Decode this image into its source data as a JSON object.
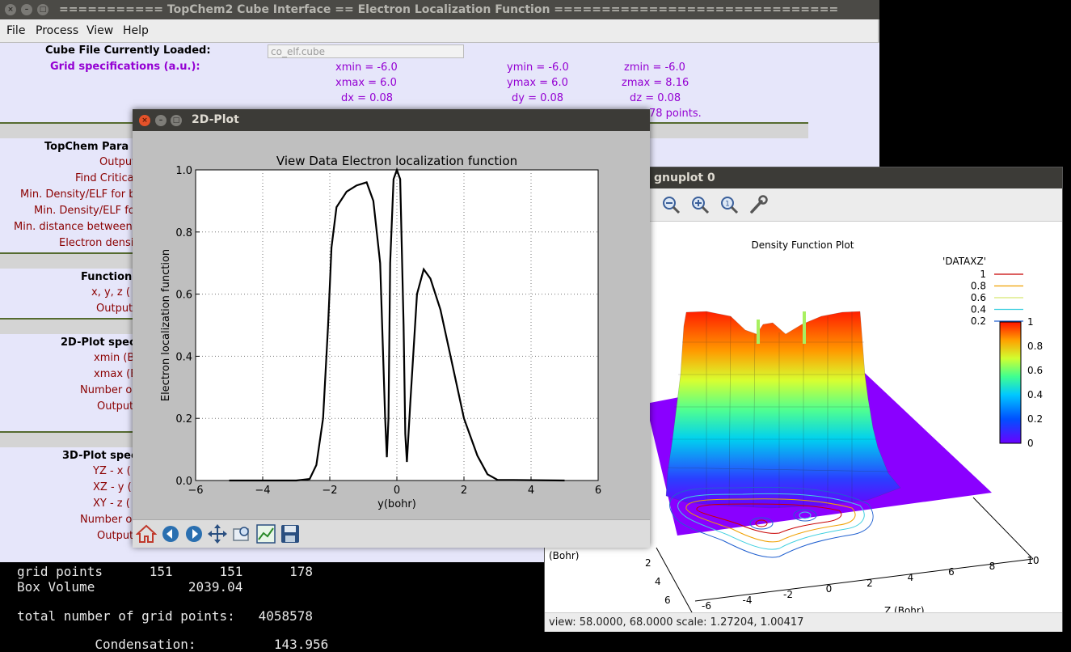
{
  "main_window": {
    "title": "=========== TopChem2 Cube Interface == Electron Localization Function ==============================",
    "menu": [
      "File",
      "Process",
      "View",
      "Help"
    ],
    "cube_label": "Cube File Currently Loaded:",
    "cube_value": "co_elf.cube",
    "grid_label": "Grid specifications (a.u.):",
    "grid": {
      "xmin": "xmin = -6.0",
      "xmax": "xmax = 6.0",
      "dx": "dx = 0.08",
      "ymin": "ymin = -6.0",
      "ymax": "ymax = 6.0",
      "dy": "dy = 0.08",
      "zmin": "zmin = -6.0",
      "zmax": "zmax = 8.16",
      "dz": "dz = 0.08",
      "points": "78 points."
    },
    "section_topchem": "TopChem Para",
    "topchem_rows": [
      "Output",
      "Find Critica",
      "Min. Density/ELF for b",
      "Min. Density/ELF fo",
      "Min. distance between",
      "Electron densi"
    ],
    "section_function": "Function",
    "function_rows": [
      "x, y, z (",
      "Output t"
    ],
    "section_2d": "2D-Plot spec",
    "plot2d_rows": [
      "xmin (B",
      "xmax (B",
      "Number o",
      "Output"
    ],
    "section_3d": "3D-Plot spec",
    "plot3d_rows": [
      "YZ - x (",
      "XZ - y (",
      "XY - z (",
      "Number o",
      "Output"
    ]
  },
  "terminal": {
    "line1": "grid points      151      151      178",
    "line2": "Box Volume            2039.04",
    "line3": "total number of grid points:   4058578",
    "line4": "          Condensation:          143.956"
  },
  "plot_window": {
    "title": "2D-Plot",
    "toolbar": [
      "home-icon",
      "back-icon",
      "forward-icon",
      "pan-icon",
      "zoom-rect-icon",
      "subplots-icon",
      "save-icon"
    ]
  },
  "chart_data": [
    {
      "type": "line",
      "title": "View Data Electron localization function",
      "xlabel": "y(bohr)",
      "ylabel": "Electron localization function",
      "xlim": [
        -6,
        6
      ],
      "ylim": [
        0,
        1.0
      ],
      "xticks": [
        "−6",
        "−4",
        "−2",
        "0",
        "2",
        "4",
        "6"
      ],
      "yticks": [
        "0.0",
        "0.2",
        "0.4",
        "0.6",
        "0.8",
        "1.0"
      ],
      "grid": true,
      "series": [
        {
          "x": [
            -5,
            -3,
            -2.6,
            -2.4,
            -2.2,
            -2.05,
            -1.95,
            -1.8,
            -1.5,
            -1.2,
            -0.9,
            -0.7,
            -0.5,
            -0.35,
            -0.3,
            -0.25,
            -0.2,
            -0.1,
            0,
            0.1,
            0.2,
            0.25,
            0.3,
            0.4,
            0.6,
            0.8,
            1.0,
            1.3,
            1.6,
            2.0,
            2.4,
            2.7,
            3.0,
            5
          ],
          "y": [
            0,
            0,
            0.005,
            0.05,
            0.2,
            0.5,
            0.75,
            0.88,
            0.93,
            0.95,
            0.96,
            0.9,
            0.7,
            0.2,
            0.075,
            0.2,
            0.7,
            0.97,
            1.0,
            0.97,
            0.5,
            0.15,
            0.06,
            0.25,
            0.6,
            0.68,
            0.65,
            0.55,
            0.4,
            0.2,
            0.08,
            0.02,
            0.002,
            0
          ]
        }
      ]
    },
    {
      "type": "surface",
      "title": "Density Function Plot",
      "legend_title": "'DATAXZ'",
      "legend": [
        "1",
        "0.8",
        "0.6",
        "0.4",
        "0.2"
      ],
      "legend_colors": [
        "#c80000",
        "#f0a000",
        "#d8e870",
        "#40d0e0",
        "#2060d0"
      ],
      "colorbar_ticks": [
        "1",
        "0.8",
        "0.6",
        "0.4",
        "0.2",
        "0"
      ],
      "axis_ticks_left": [
        "2",
        "4",
        "6"
      ],
      "axis_ticks_bottom": [
        "-6",
        "-4",
        "-2",
        "0",
        "2",
        "4",
        "6",
        "8",
        "10"
      ],
      "axis_label_left": "(Bohr)",
      "axis_label_bottom": "Z (Bohr)"
    }
  ],
  "gnuplot_window": {
    "title": "gnuplot 0",
    "toolbar": [
      "zoom-out-icon",
      "zoom-in-icon",
      "zoom-fit-icon",
      "wrench-icon"
    ],
    "status": "view: 58.0000, 68.0000   scale: 1.27204, 1.00417"
  }
}
